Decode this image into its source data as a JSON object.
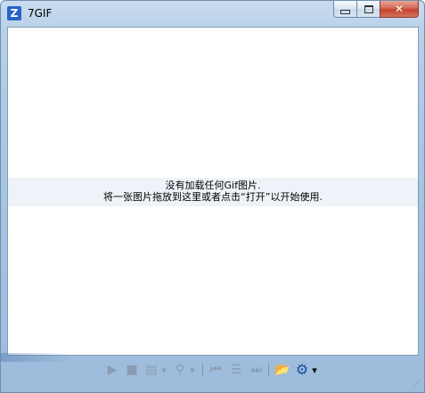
{
  "window": {
    "title": "7GIF",
    "app_icon_letter": "Z",
    "buttons": {
      "minimize_icon": "minimize-icon",
      "maximize_icon": "maximize-icon",
      "close_glyph": "✕"
    }
  },
  "content": {
    "empty_line1": "没有加载任何Gif图片.",
    "empty_line2": "将一张图片拖放到这里或者点击“打开”以开始使用."
  },
  "toolbar": {
    "play": "▶",
    "stop": "■",
    "frames": "▤",
    "frames_dropdown": "▾",
    "zoom": "⚲",
    "zoom_dropdown": "▾",
    "first_frame": "⏮",
    "frame_list": "☰",
    "last_frame": "⏭",
    "open": "📂",
    "settings": "⚙",
    "settings_dropdown": "▾"
  },
  "colors": {
    "frame": "#a9c6e2",
    "close": "#c4432b",
    "icon_enabled": "#1f4f9a",
    "icon_disabled": "#8a9bb0"
  }
}
